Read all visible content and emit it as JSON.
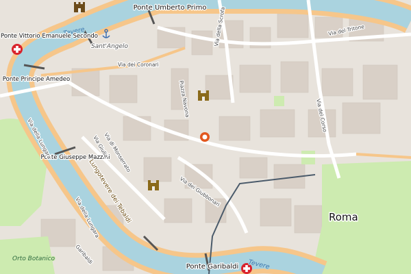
{
  "map": {
    "city_label": "Roma",
    "water_labels": [
      "Tevere",
      "Tevere"
    ],
    "landmark_labels": [
      "Sant'Angelo"
    ],
    "park_labels": [
      "Orto Botanico"
    ],
    "bridge_labels": [
      "Ponte Umberto Primo",
      "Ponte Vittorio Emanuele Secondo",
      "Ponte Principe Amedeo",
      "Ponte Giuseppe Mazzini",
      "Ponte Garibaldi"
    ],
    "street_labels": [
      "Via dei Coronari",
      "Piazza Navona",
      "Via della Scrofa",
      "Via del Tritone",
      "Via del Corso",
      "Via della Lungara",
      "Via Giulia",
      "Via di Monserrato",
      "Lungotevere dei Tebaldi",
      "Via dei Giubbonari",
      "Via della Lungara",
      "Garibaldi"
    ],
    "colors": {
      "background": "#f2efe9",
      "river": "#aad3df",
      "river_edge": "#8db8c8",
      "riverside_road": "#f6c68a",
      "major_road": "#ffffff",
      "building": "#d9d0c7",
      "park": "#cdebb0",
      "hospital_marker": "#d9232c",
      "location_pin": "#e2571e",
      "tram_line": "#4a5a6a"
    },
    "icons": [
      "hospital-icon",
      "castle-icon",
      "anchor-icon",
      "palace-icon",
      "location-pin-icon"
    ]
  }
}
